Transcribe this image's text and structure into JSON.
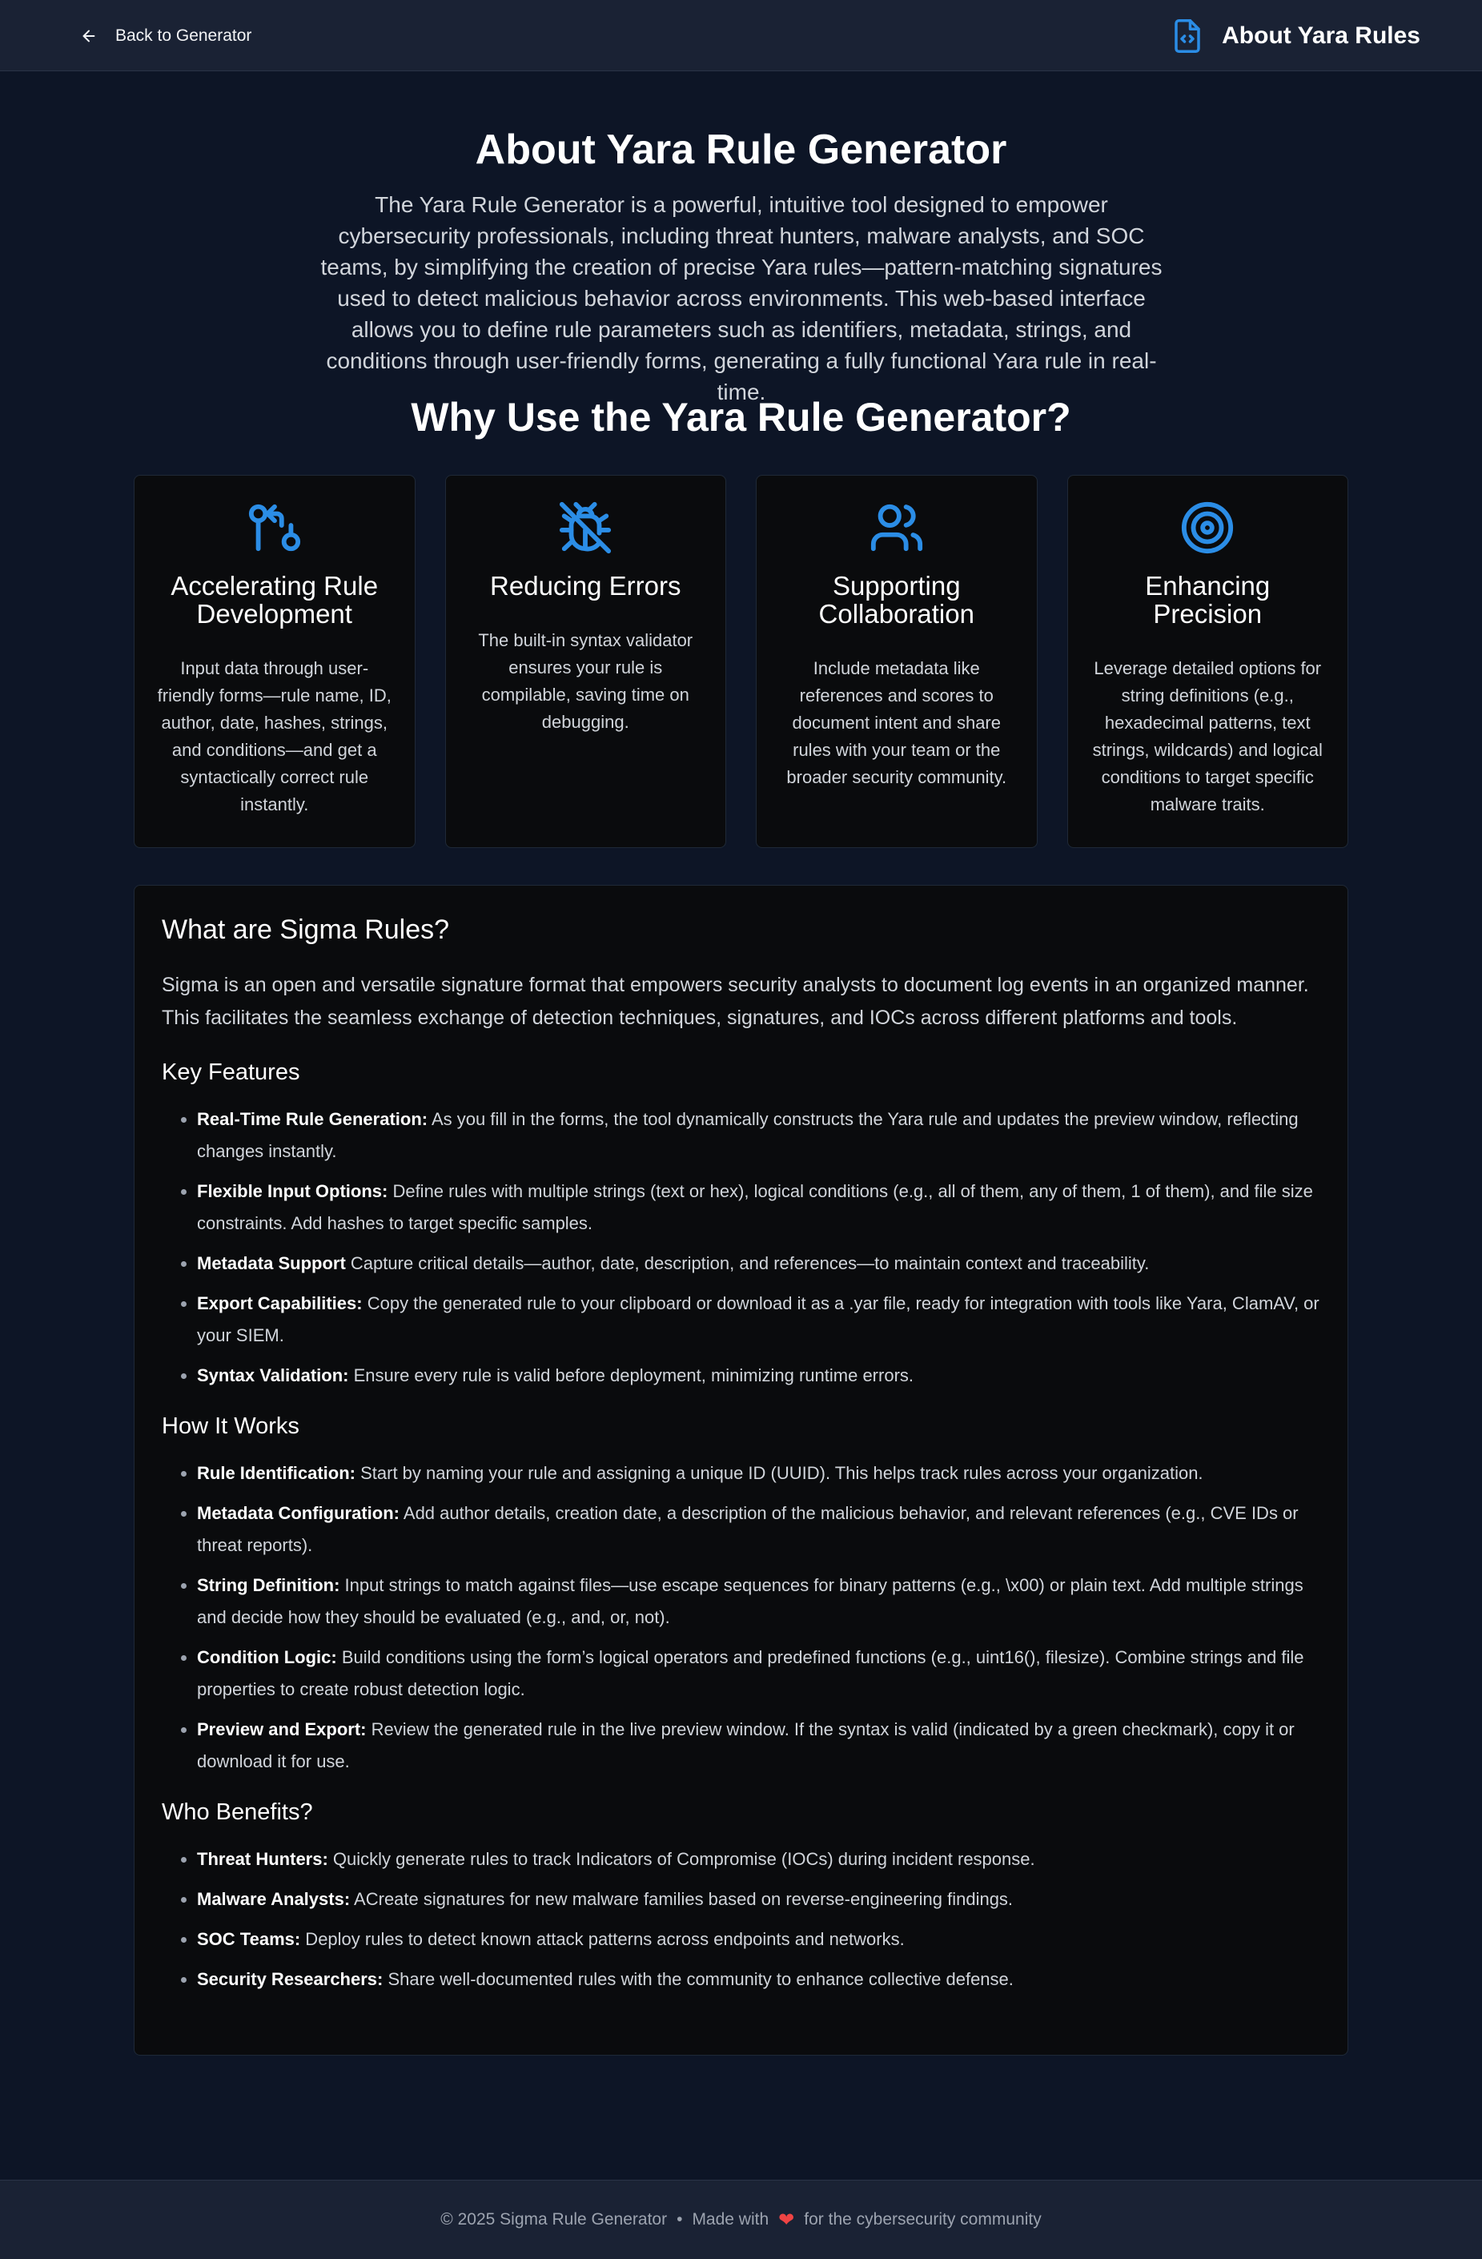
{
  "header": {
    "back_label": "Back to Generator",
    "brand_title": "About Yara Rules",
    "back_icon": "arrow-left-icon",
    "brand_icon": "file-code-icon"
  },
  "hero": {
    "title": "About Yara Rule Generator",
    "description": "The Yara Rule Generator is a powerful, intuitive tool designed to empower cybersecurity professionals, including threat hunters, malware analysts, and SOC teams, by simplifying the creation of precise Yara rules—pattern-matching signatures used to detect malicious behavior across environments. This web-based interface allows you to define rule parameters such as identifiers, metadata, strings, and conditions through user-friendly forms, generating a fully functional Yara rule in real-time."
  },
  "why": {
    "title": "Why Use the Yara Rule Generator?",
    "cards": [
      {
        "icon": "git-compare-icon",
        "title": "Accelerating Rule Development",
        "text": "Input data through user-friendly forms—rule name, ID, author, date, hashes, strings, and conditions—and get a syntactically correct rule instantly."
      },
      {
        "icon": "bug-off-icon",
        "title": "Reducing Errors",
        "text": "The built-in syntax validator ensures your rule is compilable, saving time on debugging."
      },
      {
        "icon": "users-icon",
        "title": "Supporting Collaboration",
        "text": "Include metadata like references and scores to document intent and share rules with your team or the broader security community."
      },
      {
        "icon": "target-icon",
        "title": "Enhancing Precision",
        "text": "Leverage detailed options for string definitions (e.g., hexadecimal patterns, text strings, wildcards) and logical conditions to target specific malware traits."
      }
    ]
  },
  "sigma": {
    "title": "What are Sigma Rules?",
    "intro": "Sigma is an open and versatile signature format that empowers security analysts to document log events in an organized manner. This facilitates the seamless exchange of detection techniques, signatures, and IOCs across different platforms and tools.",
    "sections": [
      {
        "title": "Key Features",
        "items": [
          {
            "label": "Real-Time Rule Generation:",
            "text": " As you fill in the forms, the tool dynamically constructs the Yara rule and updates the preview window, reflecting changes instantly."
          },
          {
            "label": "Flexible Input Options:",
            "text": " Define rules with multiple strings (text or hex), logical conditions (e.g., all of them, any of them, 1 of them), and file size constraints. Add hashes to target specific samples."
          },
          {
            "label": "Metadata Support",
            "text": " Capture critical details—author, date, description, and references—to maintain context and traceability."
          },
          {
            "label": "Export Capabilities:",
            "text": " Copy the generated rule to your clipboard or download it as a .yar file, ready for integration with tools like Yara, ClamAV, or your SIEM."
          },
          {
            "label": "Syntax Validation:",
            "text": " Ensure every rule is valid before deployment, minimizing runtime errors."
          }
        ]
      },
      {
        "title": "How It Works",
        "items": [
          {
            "label": "Rule Identification:",
            "text": " Start by naming your rule and assigning a unique ID (UUID). This helps track rules across your organization."
          },
          {
            "label": "Metadata Configuration:",
            "text": " Add author details, creation date, a description of the malicious behavior, and relevant references (e.g., CVE IDs or threat reports)."
          },
          {
            "label": "String Definition:",
            "text": " Input strings to match against files—use escape sequences for binary patterns (e.g., \\x00) or plain text. Add multiple strings and decide how they should be evaluated (e.g., and, or, not)."
          },
          {
            "label": "Condition Logic:",
            "text": " Build conditions using the form’s logical operators and predefined functions (e.g., uint16(), filesize). Combine strings and file properties to create robust detection logic."
          },
          {
            "label": "Preview and Export:",
            "text": " Review the generated rule in the live preview window. If the syntax is valid (indicated by a green checkmark), copy it or download it for use."
          }
        ]
      },
      {
        "title": "Who Benefits?",
        "items": [
          {
            "label": "Threat Hunters:",
            "text": " Quickly generate rules to track Indicators of Compromise (IOCs) during incident response."
          },
          {
            "label": "Malware Analysts:",
            "text": " ACreate signatures for new malware families based on reverse-engineering findings."
          },
          {
            "label": "SOC Teams:",
            "text": " Deploy rules to detect known attack patterns across endpoints and networks."
          },
          {
            "label": "Security Researchers:",
            "text": " Share well-documented rules with the community to enhance collective defense."
          }
        ]
      }
    ]
  },
  "footer": {
    "copyright": "© 2025 Sigma Rule Generator",
    "separator": "•",
    "made_with": "Made with",
    "heart": "❤",
    "suffix": "for the cybersecurity community"
  },
  "colors": {
    "page_bg": "#0d1526",
    "header_bg": "#1a2234",
    "card_bg": "#0a0b0d",
    "accent_blue": "#2b8de6",
    "heart_red": "#ef4444"
  }
}
